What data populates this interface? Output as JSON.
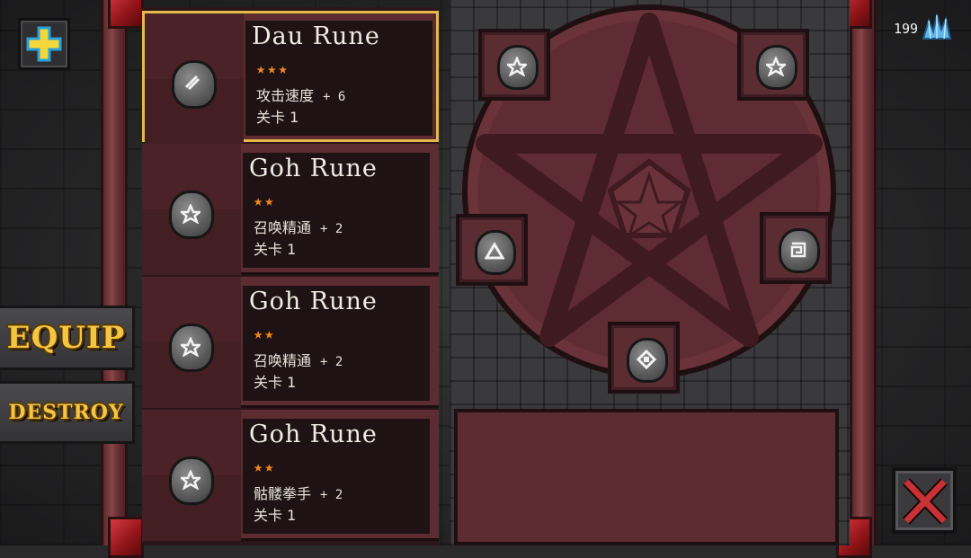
{
  "currency": {
    "amount": "199",
    "icon": "blue-crystal-icon"
  },
  "buttons": {
    "add": {
      "icon": "plus-icon"
    },
    "equip_label": "EQUIP",
    "destroy_label": "DESTROY",
    "close": {
      "icon": "close-x-icon"
    }
  },
  "runes": [
    {
      "name": "Dau Rune",
      "stars": "★★★",
      "stat": "攻击速度",
      "value": "+ 6",
      "level": "关卡 1",
      "icon": "rune-slash-icon",
      "selected": true
    },
    {
      "name": "Goh Rune",
      "stars": "★★",
      "stat": "召唤精通",
      "value": "+ 2",
      "level": "关卡 1",
      "icon": "rune-pentagram-icon",
      "selected": false
    },
    {
      "name": "Goh Rune",
      "stars": "★★",
      "stat": "召唤精通",
      "value": "+ 2",
      "level": "关卡 1",
      "icon": "rune-pentagram-icon",
      "selected": false
    },
    {
      "name": "Goh Rune",
      "stars": "★★",
      "stat": "骷髅拳手",
      "value": "+ 2",
      "level": "关卡 1",
      "icon": "rune-pentagram-icon",
      "selected": false
    }
  ],
  "slots": [
    {
      "position": "top-left",
      "icon": "rune-pentagram-icon"
    },
    {
      "position": "top-right",
      "icon": "rune-pentagram-icon"
    },
    {
      "position": "left",
      "icon": "rune-triangle-icon"
    },
    {
      "position": "right",
      "icon": "rune-square-spiral-icon"
    },
    {
      "position": "bottom",
      "icon": "rune-diamond-icon"
    }
  ],
  "colors": {
    "accent_gold": "#f5c544",
    "star": "#f08a1f",
    "selection": "#e6b84a",
    "panel": "#5c2c32"
  }
}
